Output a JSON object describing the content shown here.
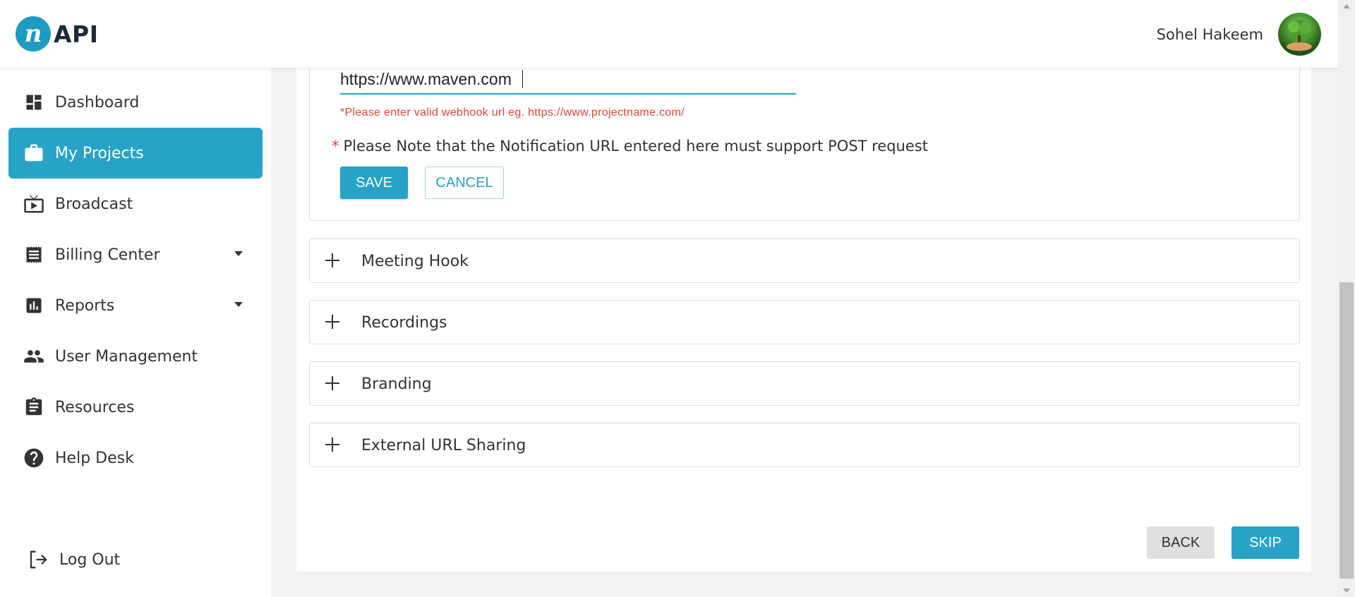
{
  "header": {
    "logo_letter": "n",
    "logo_text": "API",
    "user_name": "Sohel Hakeem"
  },
  "sidebar": {
    "items": [
      {
        "label": "Dashboard",
        "icon": "dashboard-icon"
      },
      {
        "label": "My Projects",
        "icon": "briefcase-icon",
        "active": true
      },
      {
        "label": "Broadcast",
        "icon": "tv-icon"
      },
      {
        "label": "Billing Center",
        "icon": "receipt-icon",
        "has_caret": true
      },
      {
        "label": "Reports",
        "icon": "bar-chart-icon",
        "has_caret": true
      },
      {
        "label": "User Management",
        "icon": "people-icon"
      },
      {
        "label": "Resources",
        "icon": "clipboard-icon"
      },
      {
        "label": "Help Desk",
        "icon": "help-icon"
      }
    ],
    "logout_label": "Log Out"
  },
  "webhook": {
    "url_value": "https://www.maven.com",
    "error_text": "*Please enter valid webhook url eg. https://www.projectname.com/",
    "note_star": "*",
    "note_text": "Please Note that the Notification URL entered here must support POST request",
    "save_label": "SAVE",
    "cancel_label": "CANCEL"
  },
  "accordions": [
    {
      "label": "Meeting Hook"
    },
    {
      "label": "Recordings"
    },
    {
      "label": "Branding"
    },
    {
      "label": "External URL Sharing"
    }
  ],
  "footer": {
    "back_label": "BACK",
    "skip_label": "SKIP"
  },
  "colors": {
    "accent": "#27a3c7",
    "error": "#e8413b",
    "active_nav": "#27a3c7"
  }
}
